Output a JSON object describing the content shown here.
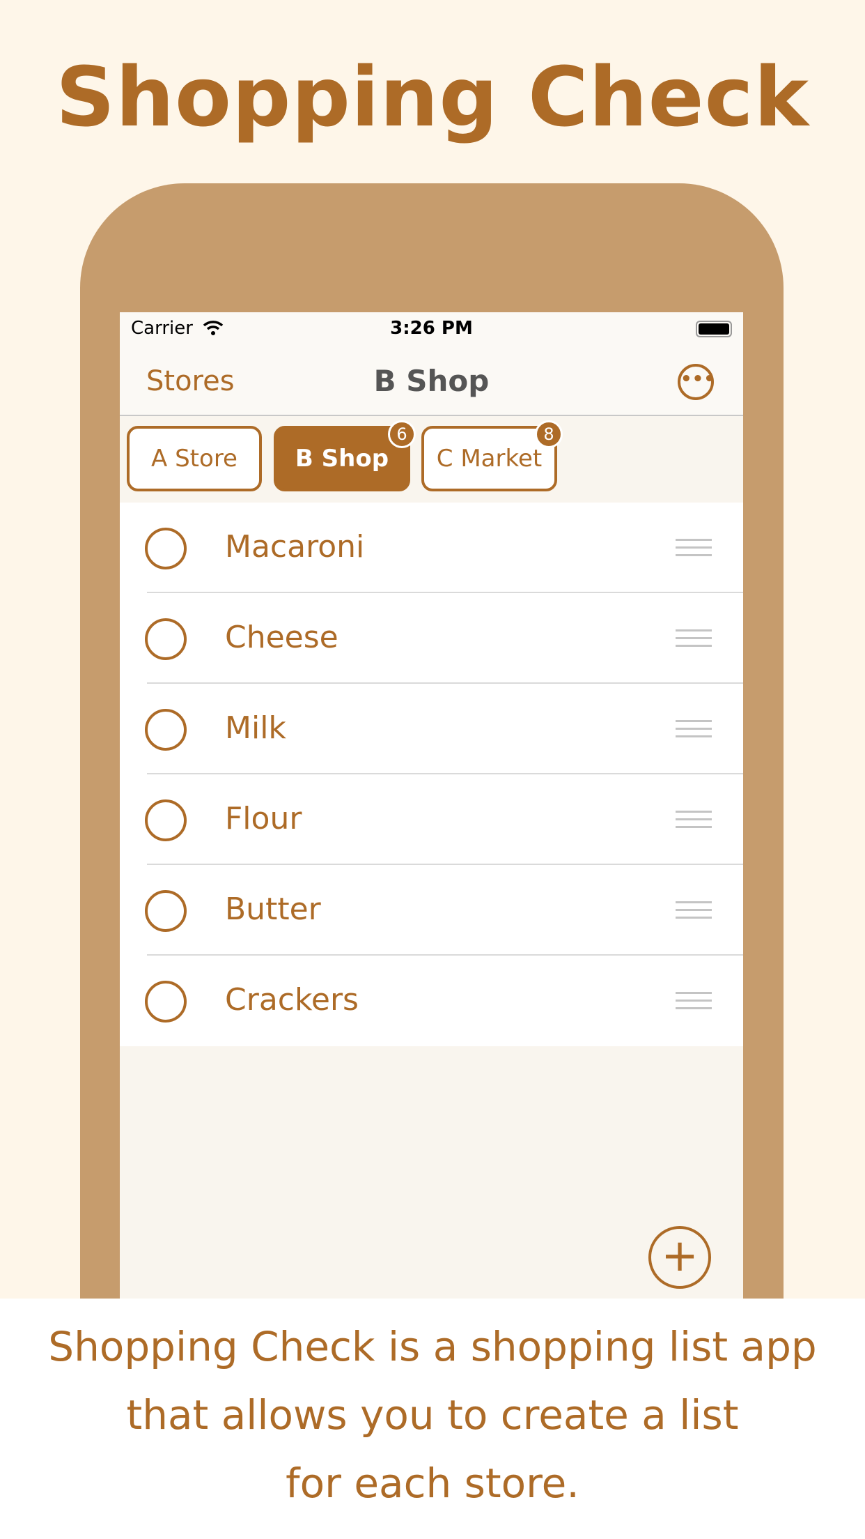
{
  "headline": "Shopping Check",
  "status": {
    "carrier": "Carrier",
    "time": "3:26 PM"
  },
  "nav": {
    "back": "Stores",
    "title": "B Shop",
    "more_icon": "ellipsis-circle-icon"
  },
  "tabs": [
    {
      "label": "A Store",
      "badge": null,
      "selected": false
    },
    {
      "label": "B Shop",
      "badge": "6",
      "selected": true
    },
    {
      "label": "C Market",
      "badge": "8",
      "selected": false
    }
  ],
  "items": [
    {
      "name": "Macaroni"
    },
    {
      "name": "Cheese"
    },
    {
      "name": "Milk"
    },
    {
      "name": "Flour"
    },
    {
      "name": "Butter"
    },
    {
      "name": "Crackers"
    }
  ],
  "add_icon": "plus-circle-icon",
  "description": [
    "Shopping Check is a shopping list app",
    "that allows you to create a list",
    "for each store."
  ],
  "colors": {
    "accent": "#ad6b27",
    "frame": "#c69c6d",
    "background": "#fef6e9"
  }
}
